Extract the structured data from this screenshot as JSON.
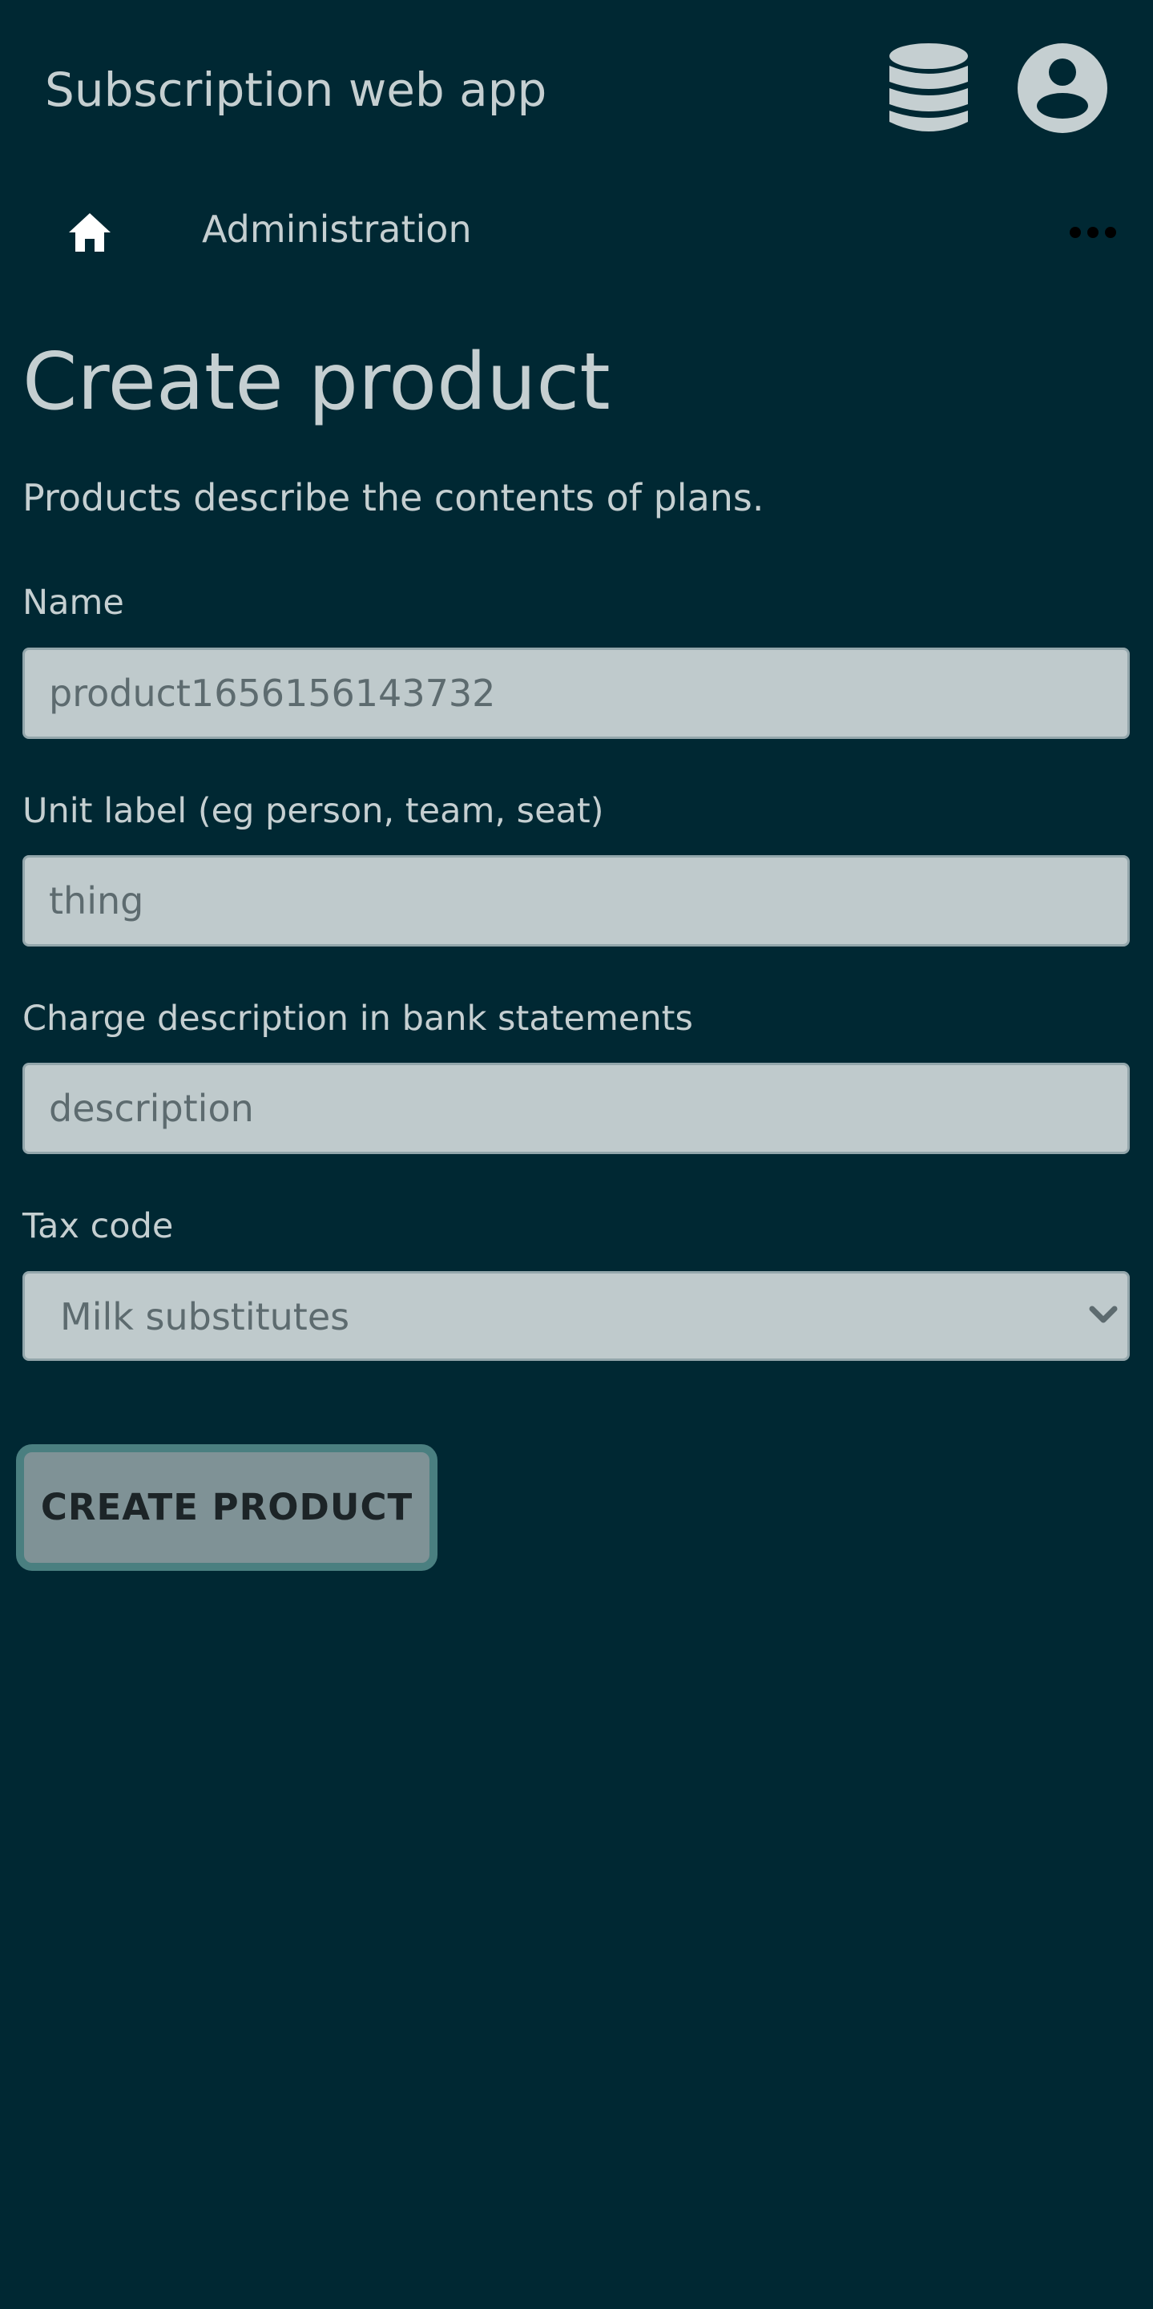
{
  "header": {
    "app_title": "Subscription web app",
    "icons": [
      "database-icon",
      "user-circle-icon"
    ]
  },
  "nav": {
    "home_icon": "home-icon",
    "admin_label": "Administration",
    "more_icon": "more-horizontal-icon"
  },
  "page": {
    "title": "Create product",
    "description": "Products describe the contents of plans."
  },
  "form": {
    "name": {
      "label": "Name",
      "value": "",
      "placeholder": "product1656156143732"
    },
    "unit_label": {
      "label": "Unit label (eg person, team, seat)",
      "value": "",
      "placeholder": "thing"
    },
    "charge_description": {
      "label": "Charge description in bank statements",
      "value": "",
      "placeholder": "description"
    },
    "tax_code": {
      "label": "Tax code",
      "selected": "Milk substitutes"
    },
    "submit_label": "CREATE PRODUCT"
  },
  "colors": {
    "background": "#002833",
    "text": "#c5cfd1",
    "input_background": "#bfcacc",
    "input_text": "#5d6b6f",
    "button_background": "#7f9296",
    "button_border": "#4a7f80"
  }
}
